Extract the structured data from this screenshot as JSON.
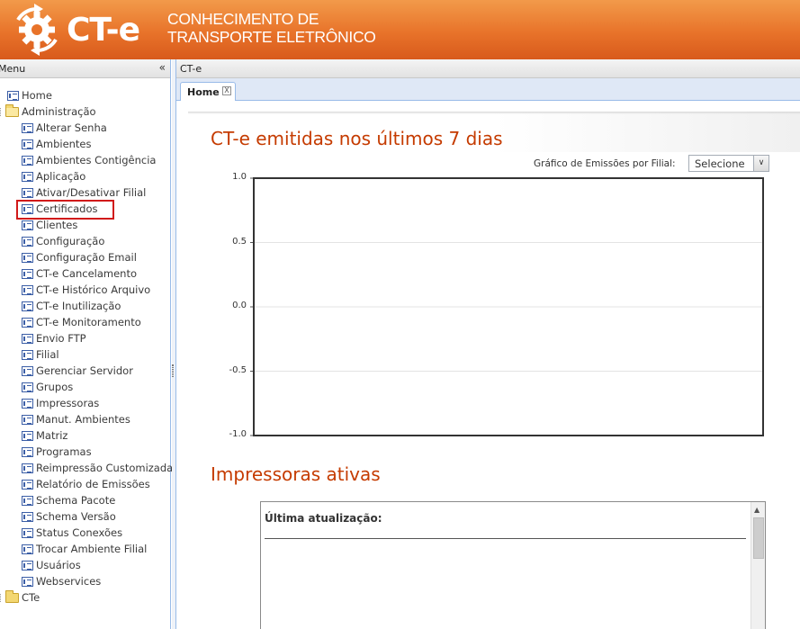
{
  "header": {
    "logo_text": "CT-e",
    "subtitle_line1": "CONHECIMENTO DE",
    "subtitle_line2": "TRANSPORTE ELETRÔNICO"
  },
  "left_panel": {
    "title": "Menu",
    "collapse_icon": "«",
    "tree": [
      {
        "label": "Home",
        "type": "leaf",
        "level": 0
      },
      {
        "label": "Administração",
        "type": "folder-open",
        "level": 0
      },
      {
        "label": "Alterar Senha",
        "type": "leaf",
        "level": 1
      },
      {
        "label": "Ambientes",
        "type": "leaf",
        "level": 1
      },
      {
        "label": "Ambientes Contigência",
        "type": "leaf",
        "level": 1
      },
      {
        "label": "Aplicação",
        "type": "leaf",
        "level": 1
      },
      {
        "label": "Ativar/Desativar Filial",
        "type": "leaf",
        "level": 1
      },
      {
        "label": "Certificados",
        "type": "leaf",
        "level": 1,
        "highlighted": true
      },
      {
        "label": "Clientes",
        "type": "leaf",
        "level": 1
      },
      {
        "label": "Configuração",
        "type": "leaf",
        "level": 1
      },
      {
        "label": "Configuração Email",
        "type": "leaf",
        "level": 1
      },
      {
        "label": "CT-e Cancelamento",
        "type": "leaf",
        "level": 1
      },
      {
        "label": "CT-e Histórico Arquivo",
        "type": "leaf",
        "level": 1
      },
      {
        "label": "CT-e Inutilização",
        "type": "leaf",
        "level": 1
      },
      {
        "label": "CT-e Monitoramento",
        "type": "leaf",
        "level": 1
      },
      {
        "label": "Envio FTP",
        "type": "leaf",
        "level": 1
      },
      {
        "label": "Filial",
        "type": "leaf",
        "level": 1
      },
      {
        "label": "Gerenciar Servidor",
        "type": "leaf",
        "level": 1
      },
      {
        "label": "Grupos",
        "type": "leaf",
        "level": 1
      },
      {
        "label": "Impressoras",
        "type": "leaf",
        "level": 1
      },
      {
        "label": "Manut. Ambientes",
        "type": "leaf",
        "level": 1
      },
      {
        "label": "Matriz",
        "type": "leaf",
        "level": 1
      },
      {
        "label": "Programas",
        "type": "leaf",
        "level": 1
      },
      {
        "label": "Reimpressão Customizada",
        "type": "leaf",
        "level": 1
      },
      {
        "label": "Relatório de Emissões",
        "type": "leaf",
        "level": 1
      },
      {
        "label": "Schema Pacote",
        "type": "leaf",
        "level": 1
      },
      {
        "label": "Schema Versão",
        "type": "leaf",
        "level": 1
      },
      {
        "label": "Status Conexões",
        "type": "leaf",
        "level": 1
      },
      {
        "label": "Trocar Ambiente Filial",
        "type": "leaf",
        "level": 1
      },
      {
        "label": "Usuários",
        "type": "leaf",
        "level": 1
      },
      {
        "label": "Webservices",
        "type": "leaf",
        "level": 1
      },
      {
        "label": "CTe",
        "type": "folder",
        "level": 0
      }
    ]
  },
  "right_panel": {
    "title": "CT-e",
    "tabs": [
      {
        "label": "Home",
        "active": true,
        "close_icon": "X"
      }
    ],
    "chart_section_title": "CT-e emitidas nos últimos 7 dias",
    "filter_label": "Gráfico de Emissões por Filial:",
    "filter_select_value": "Selecione",
    "filter_arrow": "∨",
    "printers_section_title": "Impressoras ativas",
    "printers_last_update_label": "Última atualização:"
  },
  "chart_data": {
    "type": "line",
    "title": "CT-e emitidas nos últimos 7 dias",
    "xlabel": "",
    "ylabel": "",
    "ylim": [
      -1.0,
      1.0
    ],
    "yticks": [
      "1.0",
      "0.5",
      "0.0",
      "-0.5",
      "-1.0"
    ],
    "ytick_values": [
      1.0,
      0.5,
      0.0,
      -0.5,
      -1.0
    ],
    "series": [],
    "grid": true
  }
}
